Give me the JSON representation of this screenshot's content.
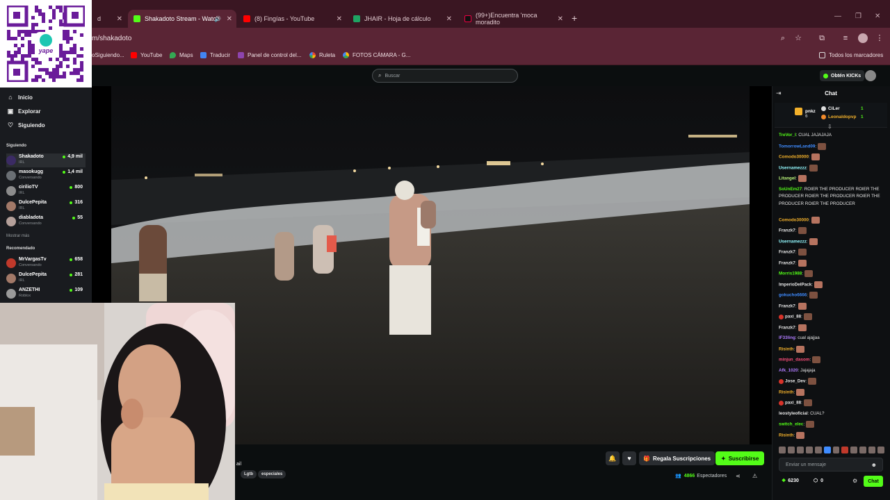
{
  "browser": {
    "tabs": [
      {
        "label": "d",
        "active": false
      },
      {
        "label": "Shakadoto Stream - Watch",
        "active": true
      },
      {
        "label": "(8) Fingías - YouTube",
        "active": false
      },
      {
        "label": "JHAIR - Hoja de cálculo",
        "active": false
      },
      {
        "label": "(99+)Encuentra 'moca moradito",
        "active": false
      }
    ],
    "url": "m/shakadoto",
    "bookmarks": [
      "oSiguiendo...",
      "YouTube",
      "Maps",
      "Traducir",
      "Panel de control del...",
      "Ruleta",
      "FOTOS CÁMARA - G..."
    ],
    "all_bookmarks": "Todos los marcadores"
  },
  "header": {
    "search_placeholder": "Buscar",
    "get_kicks": "Obtén KICKs"
  },
  "sidebar": {
    "nav": [
      "Inicio",
      "Explorar",
      "Siguiendo"
    ],
    "following_title": "Siguiendo",
    "following": [
      {
        "name": "Shakadoto",
        "sub": "IRL",
        "viewers": "4,9 mil"
      },
      {
        "name": "masokugg",
        "sub": "Conversando",
        "viewers": "1,4 mil"
      },
      {
        "name": "cirilioTV",
        "sub": "IRL",
        "viewers": "800"
      },
      {
        "name": "DulcePepita",
        "sub": "IRL",
        "viewers": "316"
      },
      {
        "name": "diabladota",
        "sub": "Conversando",
        "viewers": "55"
      }
    ],
    "show_more": "Mostrar más",
    "recommended_title": "Recomendado",
    "recommended": [
      {
        "name": "MrVargasTv",
        "sub": "Conversando",
        "viewers": "658"
      },
      {
        "name": "DulcePepita",
        "sub": "IRL",
        "viewers": "281"
      },
      {
        "name": "ANZETHI",
        "sub": "Roblox",
        "viewers": "109"
      }
    ]
  },
  "stream": {
    "title_fragment": "ail",
    "tags": [
      "Lgtb",
      "especiales"
    ],
    "gift_label": "Regala Suscripciones",
    "subscribe_label": "Suscribirse",
    "viewers": "4866",
    "viewers_label": "Espectadores"
  },
  "qr": {
    "brand": "yape"
  },
  "chat": {
    "title": "Chat",
    "pinned": [
      {
        "name": "pnkz",
        "count": "6"
      },
      {
        "name": "CiLer",
        "count": "1"
      },
      {
        "name": "Leonaldopvp",
        "count": "1"
      }
    ],
    "messages": [
      {
        "user": "TreVor_I",
        "color": "#53fc18",
        "text": ": CUAL JAJAJAJA",
        "emotes": 0
      },
      {
        "user": "TomorrowLand09",
        "color": "#3f8cff",
        "text": ":",
        "emotes": 1
      },
      {
        "user": "Comodo30000",
        "color": "#f3b12b",
        "text": ":",
        "emotes": 1
      },
      {
        "user": "Usernamezzz",
        "color": "#93f9ff",
        "text": ":",
        "emotes": 1
      },
      {
        "user": "Litangel",
        "color": "#b9f37a",
        "text": ":",
        "emotes": 1
      },
      {
        "user": "SoUnEm27",
        "color": "#53fc18",
        "text": ": ROIER THE PRODUCER ROIER THE PRODUCER ROIER THE PRODUCER ROIER THE PRODUCER ROIER THE PRODUCER",
        "emotes": 0
      },
      {
        "user": "Comodo30000",
        "color": "#f3b12b",
        "text": ":",
        "emotes": 1
      },
      {
        "user": "Franzk7",
        "color": "#e6e6e6",
        "text": ":",
        "emotes": 1
      },
      {
        "user": "Usernamezzz",
        "color": "#93f9ff",
        "text": ":",
        "emotes": 1
      },
      {
        "user": "Franzk7",
        "color": "#e6e6e6",
        "text": ":",
        "emotes": 1
      },
      {
        "user": "Franzk7",
        "color": "#e6e6e6",
        "text": ":",
        "emotes": 1
      },
      {
        "user": "Morris1988",
        "color": "#53fc18",
        "text": ":",
        "emotes": 1
      },
      {
        "user": "ImperioDelPack",
        "color": "#e6e6e6",
        "text": ":",
        "emotes": 1
      },
      {
        "user": "gokucho6666",
        "color": "#3f8cff",
        "text": ":",
        "emotes": 1
      },
      {
        "user": "Franzk7",
        "color": "#e6e6e6",
        "text": ":",
        "emotes": 1
      },
      {
        "user": "paxi_88",
        "color": "#e6e6e6",
        "text": ":",
        "emotes": 1
      },
      {
        "user": "Franzk7",
        "color": "#e6e6e6",
        "text": ":",
        "emotes": 1
      },
      {
        "user": "IF33ling",
        "color": "#b07cff",
        "text": ": cual ajajjaa",
        "emotes": 0
      },
      {
        "user": "Risinth",
        "color": "#f3b12b",
        "text": ":",
        "emotes": 1
      },
      {
        "user": "minjun_dasom",
        "color": "#ff4f7b",
        "text": ":",
        "emotes": 1
      },
      {
        "user": "Afk_1020",
        "color": "#b07cff",
        "text": ": Jajajaja",
        "emotes": 0
      },
      {
        "user": "Jose_Dev",
        "color": "#e6e6e6",
        "text": ":",
        "emotes": 1
      },
      {
        "user": "Risinth",
        "color": "#f3b12b",
        "text": ":",
        "emotes": 1
      },
      {
        "user": "paxi_88",
        "color": "#e6e6e6",
        "text": ":",
        "emotes": 1
      },
      {
        "user": "leostyleoficial",
        "color": "#e6e6e6",
        "text": ": CUAL?",
        "emotes": 0
      },
      {
        "user": "switch_elec",
        "color": "#53fc18",
        "text": ":",
        "emotes": 1
      },
      {
        "user": "Risinth",
        "color": "#f3b12b",
        "text": ":",
        "emotes": 1
      }
    ],
    "input_placeholder": "Enviar un mensaje",
    "kicks": "6230",
    "points": "0",
    "send_label": "Chat"
  },
  "colors": {
    "kick_green": "#53fc18",
    "chrome_dark": "#3a1622",
    "chrome": "#5a2535",
    "qr_purple": "#6a1b9a"
  }
}
